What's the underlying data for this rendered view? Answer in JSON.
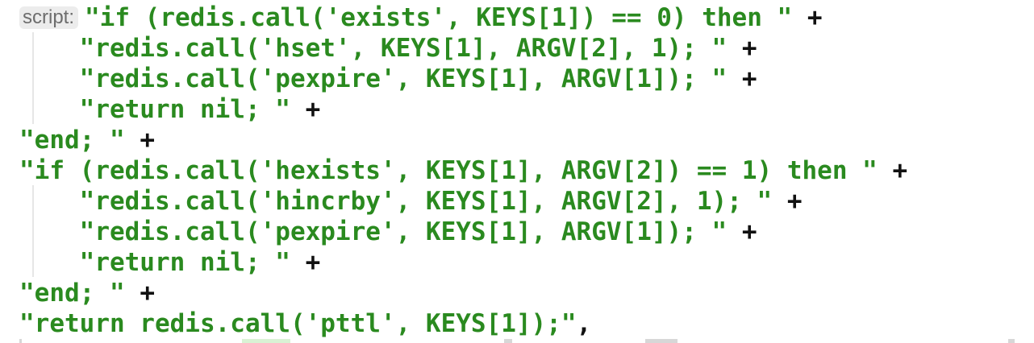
{
  "inlay_hint": "script:",
  "code_lines": [
    {
      "text": "\"if (redis.call('exists', KEYS[1]) == 0) then \"",
      "op": " +"
    },
    {
      "text": "    \"redis.call('hset', KEYS[1], ARGV[2], 1); \"",
      "op": " +"
    },
    {
      "text": "    \"redis.call('pexpire', KEYS[1], ARGV[1]); \"",
      "op": " +"
    },
    {
      "text": "    \"return nil; \"",
      "op": " +"
    },
    {
      "text": "\"end; \"",
      "op": " +"
    },
    {
      "text": "\"if (redis.call('hexists', KEYS[1], ARGV[2]) == 1) then \"",
      "op": " +"
    },
    {
      "text": "    \"redis.call('hincrby', KEYS[1], ARGV[2], 1); \"",
      "op": " +"
    },
    {
      "text": "    \"redis.call('pexpire', KEYS[1], ARGV[1]); \"",
      "op": " +"
    },
    {
      "text": "    \"return nil; \"",
      "op": " +"
    },
    {
      "text": "\"end; \"",
      "op": " +"
    },
    {
      "text": "\"return redis.call('pttl', KEYS[1]);\"",
      "op": ","
    }
  ],
  "colors": {
    "string": "#2a8a1f",
    "operator": "#111111",
    "hint_text": "#6d6d6d",
    "hint_background": "#ececec"
  }
}
